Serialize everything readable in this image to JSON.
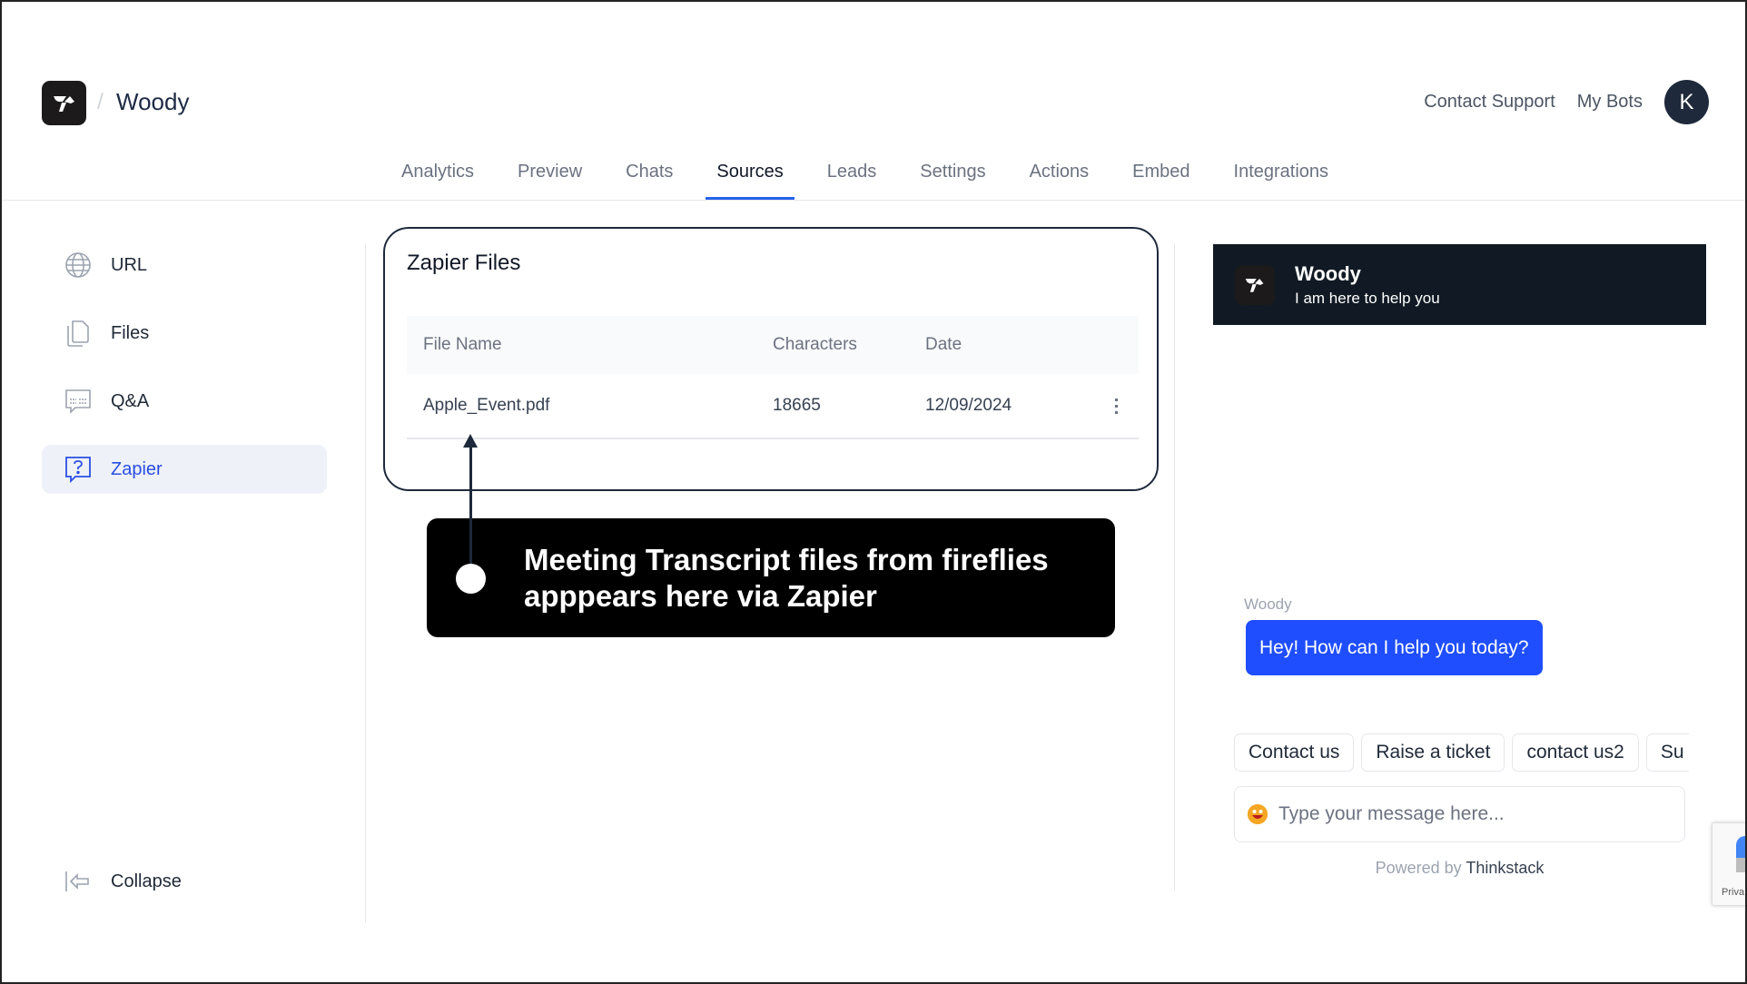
{
  "header": {
    "bot_name": "Woody",
    "breadcrumb_separator": "/",
    "links": [
      "Contact Support",
      "My Bots"
    ],
    "avatar_initial": "K"
  },
  "tabs": [
    {
      "label": "Analytics",
      "active": false
    },
    {
      "label": "Preview",
      "active": false
    },
    {
      "label": "Chats",
      "active": false
    },
    {
      "label": "Sources",
      "active": true
    },
    {
      "label": "Leads",
      "active": false
    },
    {
      "label": "Settings",
      "active": false
    },
    {
      "label": "Actions",
      "active": false
    },
    {
      "label": "Embed",
      "active": false
    },
    {
      "label": "Integrations",
      "active": false
    }
  ],
  "sidebar": {
    "items": [
      {
        "label": "URL",
        "icon": "globe-icon",
        "active": false
      },
      {
        "label": "Files",
        "icon": "files-icon",
        "active": false
      },
      {
        "label": "Q&A",
        "icon": "qa-chat-icon",
        "active": false
      },
      {
        "label": "Zapier",
        "icon": "question-chat-icon",
        "active": true
      }
    ],
    "collapse_label": "Collapse"
  },
  "zapier_files": {
    "title": "Zapier Files",
    "columns": [
      "File Name",
      "Characters",
      "Date"
    ],
    "rows": [
      {
        "file_name": "Apple_Event.pdf",
        "characters": "18665",
        "date": "12/09/2024"
      }
    ]
  },
  "annotation": {
    "text": "Meeting Transcript files from fireflies apppears here via Zapier"
  },
  "chat_widget": {
    "title": "Woody",
    "subtitle": "I am here to help you",
    "sender": "Woody",
    "message": "Hey! How can I help you today?",
    "quick_replies": [
      "Contact us",
      "Raise a ticket",
      "contact us2",
      "Su"
    ],
    "input_placeholder": "Type your message here...",
    "powered_by_prefix": "Powered by",
    "powered_by_brand": "Thinkstack",
    "accent_color": "#1f4eff",
    "header_color": "#111a24"
  },
  "recaptcha": {
    "label": "Priva"
  }
}
